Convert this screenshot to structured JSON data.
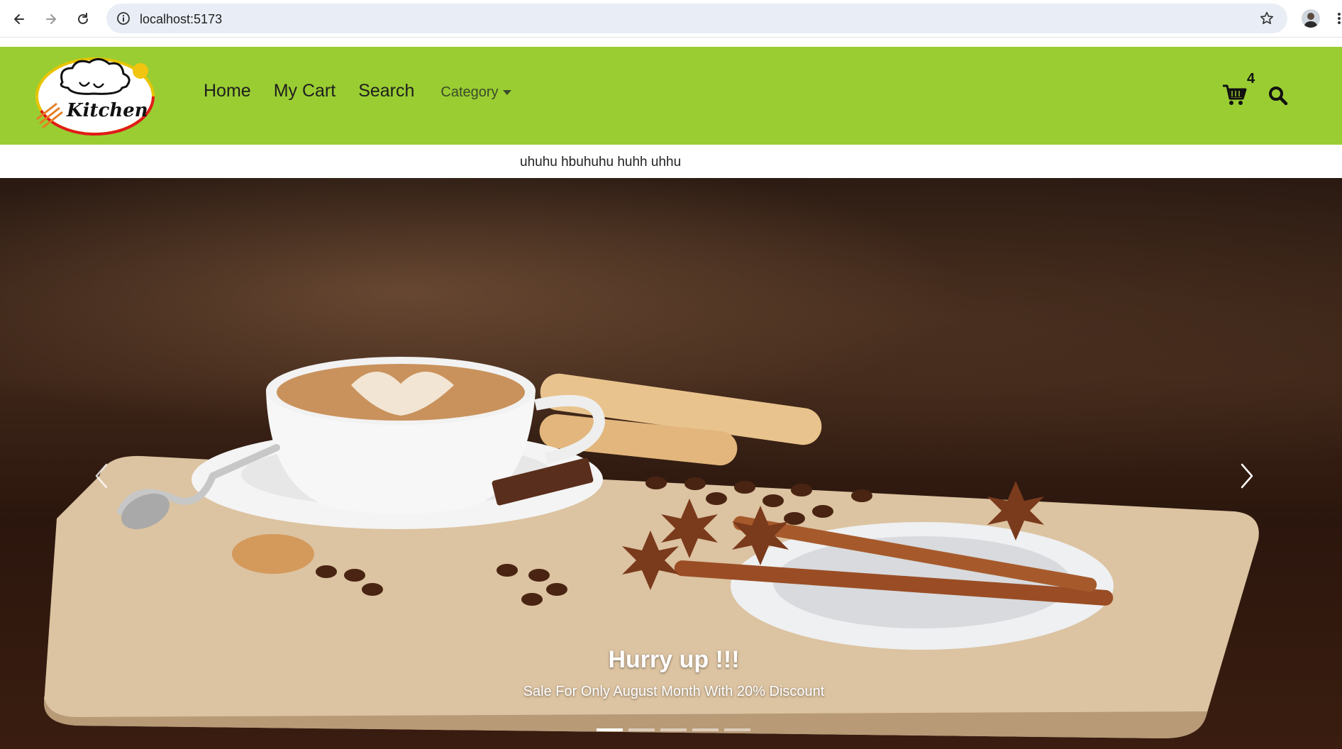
{
  "browser": {
    "url": "localhost:5173",
    "back_icon": "arrow-left-icon",
    "forward_icon": "arrow-right-icon",
    "reload_icon": "reload-icon",
    "info_icon": "info-icon",
    "bookmark_icon": "star-icon"
  },
  "header": {
    "background_color": "#9acd32",
    "logo_text": "Kitchen",
    "nav": [
      {
        "label": "Home"
      },
      {
        "label": "My Cart"
      },
      {
        "label": "Search"
      }
    ],
    "category_label": "Category",
    "cart_count": "4"
  },
  "announcement": {
    "text": "uhuhu hbuhuhu huhh uhhu"
  },
  "carousel": {
    "caption_title": "Hurry up !!!",
    "caption_subtitle": "Sale For Only August Month With 20% Discount",
    "slide_count": 5,
    "active_slide": 1
  }
}
